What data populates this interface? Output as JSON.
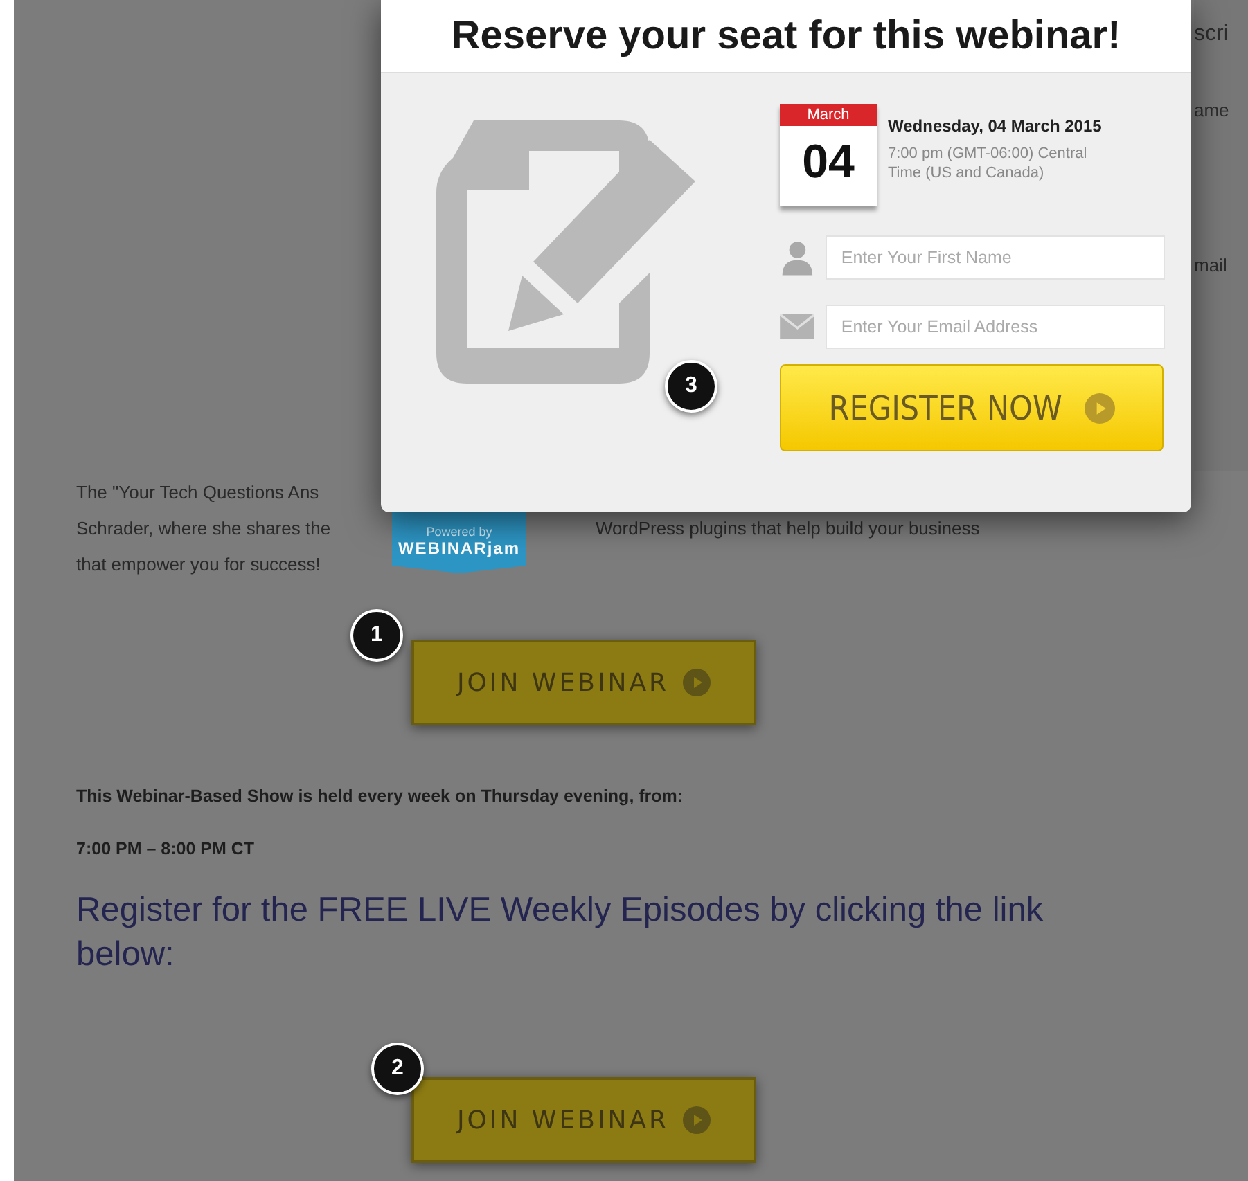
{
  "popup": {
    "title": "Reserve your seat for this webinar!",
    "date": {
      "month": "March",
      "day": "04",
      "full": "Wednesday, 04 March 2015",
      "time": "7:00 pm (GMT-06:00) Central Time (US and Canada)"
    },
    "fields": [
      {
        "kind": "name",
        "placeholder": "Enter Your First Name"
      },
      {
        "kind": "email",
        "placeholder": "Enter Your Email Address"
      }
    ],
    "button": "REGISTER NOW",
    "marker": "3"
  },
  "badge": {
    "line1": "Powered by",
    "line2": "WEBINARjam"
  },
  "sidebar_fragments": [
    "scri",
    "ame",
    "mail"
  ],
  "intro_lines": [
    [
      "The \"Your Tech Questions Ans"
    ],
    [
      "Schrader, where she shares the",
      "WordPress plugins that help build your business"
    ],
    [
      "that empower you for success!"
    ]
  ],
  "join_buttons": [
    {
      "label": "JOIN WEBINAR",
      "marker": "1"
    },
    {
      "label": "JOIN WEBINAR",
      "marker": "2"
    }
  ],
  "schedule": "This Webinar-Based Show is held every week on Thursday evening, from:",
  "hours": "7:00 PM – 8:00 PM CT",
  "heading": "Register for the FREE LIVE Weekly Episodes by clicking the link below:"
}
